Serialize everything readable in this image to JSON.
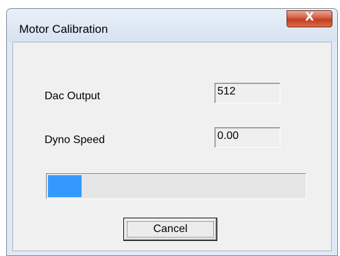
{
  "window": {
    "title": "Motor Calibration",
    "close_glyph": "X",
    "close_icon": "close-icon"
  },
  "fields": {
    "dac_output": {
      "label": "Dac Output",
      "value": "512"
    },
    "dyno_speed": {
      "label": "Dyno Speed",
      "value": "0.00"
    }
  },
  "progress": {
    "fraction": 0.13,
    "color": "#3399ff"
  },
  "buttons": {
    "cancel_label": "Cancel"
  }
}
